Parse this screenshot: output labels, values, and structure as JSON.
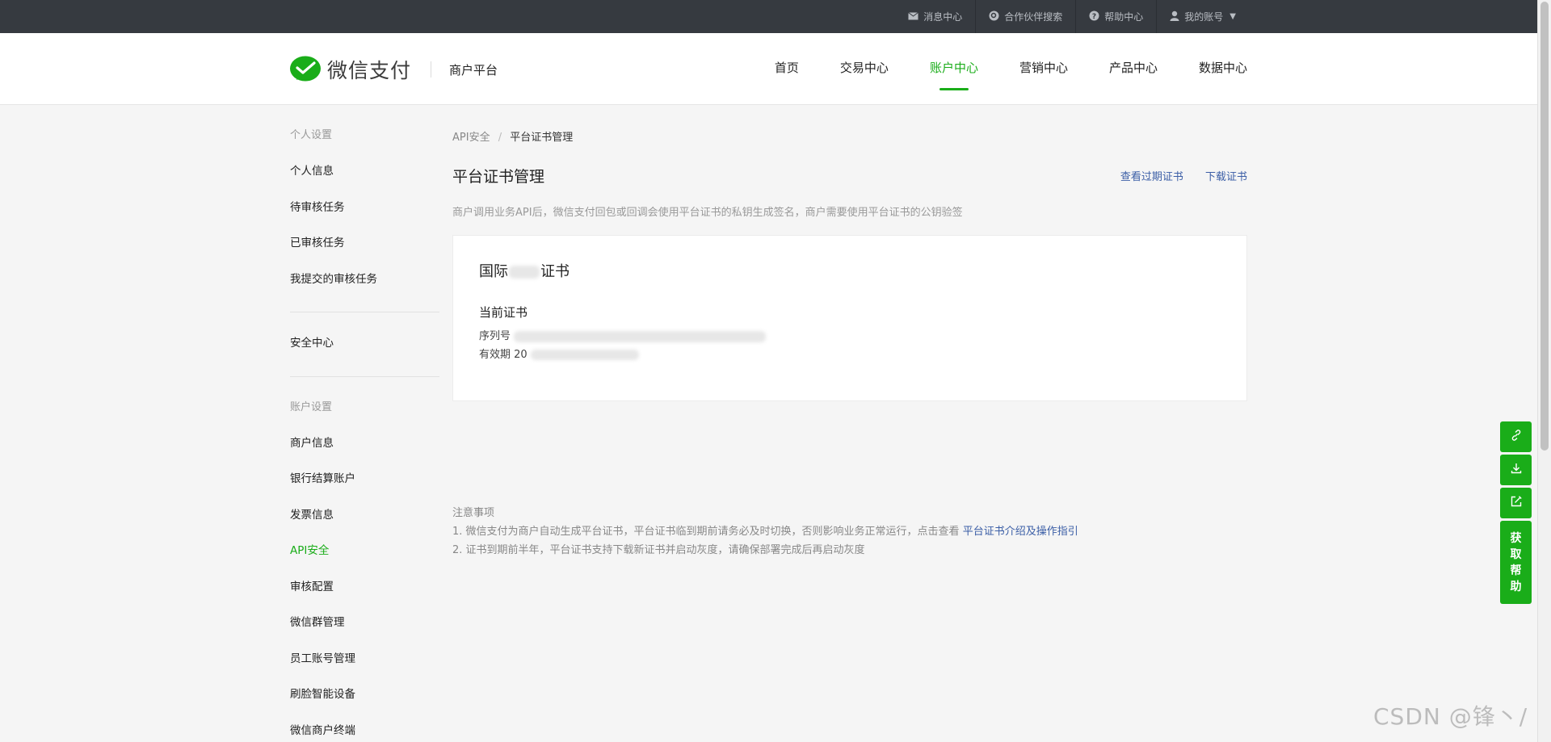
{
  "topbar": {
    "items": [
      {
        "icon": "mail-icon",
        "label": "消息中心"
      },
      {
        "icon": "search-partner-icon",
        "label": "合作伙伴搜索"
      },
      {
        "icon": "help-icon",
        "label": "帮助中心"
      },
      {
        "icon": "user-icon",
        "label": "我的账号"
      }
    ]
  },
  "header": {
    "brand": "微信支付",
    "sub": "商户平台",
    "nav": [
      "首页",
      "交易中心",
      "账户中心",
      "营销中心",
      "产品中心",
      "数据中心"
    ],
    "active_nav": "账户中心",
    "accent": "#1aad19"
  },
  "sidebar": {
    "group1": "个人设置",
    "group1_items": [
      "个人信息",
      "待审核任务",
      "已审核任务",
      "我提交的审核任务"
    ],
    "security": "安全中心",
    "group2": "账户设置",
    "group2_items": [
      "商户信息",
      "银行结算账户",
      "发票信息",
      "API安全",
      "审核配置",
      "微信群管理",
      "员工账号管理",
      "刷脸智能设备",
      "微信商户终端"
    ],
    "active_item": "API安全"
  },
  "main": {
    "breadcrumb_parent": "API安全",
    "breadcrumb_sep": "/",
    "breadcrumb_current": "平台证书管理",
    "title": "平台证书管理",
    "link_expired": "查看过期证书",
    "link_download": "下载证书",
    "description": "商户调用业务API后，微信支付回包或回调会使用平台证书的私钥生成签名，商户需要使用平台证书的公钥验签",
    "card": {
      "title": "国际",
      "title_tail": "证书",
      "current_label": "当前证书",
      "serial_label": "序列号",
      "validity_label": "有效期 20"
    }
  },
  "notes": {
    "heading": "注意事项",
    "line1": "1. 微信支付为商户自动生成平台证书，平台证书临到期前请务必及时切换，否则影响业务正常运行，点击查看",
    "line1_link": "平台证书介绍及操作指引",
    "line2": "2. 证书到期前半年，平台证书支持下载新证书并启动灰度，请确保部署完成后再启动灰度"
  },
  "tools": {
    "icons": [
      "link-icon",
      "download-icon",
      "edit-icon"
    ],
    "help_label": [
      "获",
      "取",
      "帮",
      "助"
    ]
  },
  "watermark": "CSDN @锋丶/"
}
